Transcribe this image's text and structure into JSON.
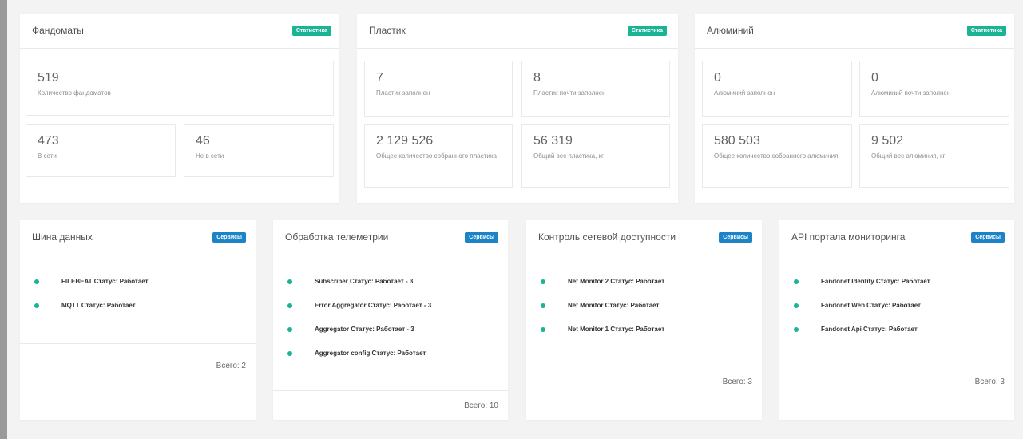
{
  "colors": {
    "accent_green": "#1ab394",
    "accent_blue": "#1c84c6",
    "background": "#f3f3f4"
  },
  "fandomats": {
    "title": "Фандоматы",
    "badge": "Статистика",
    "total_count": {
      "value": "519",
      "label": "Количество фандоматов"
    },
    "online": {
      "value": "473",
      "label": "В сети"
    },
    "offline": {
      "value": "46",
      "label": "Не в сети"
    }
  },
  "plastic": {
    "title": "Пластик",
    "badge": "Статистика",
    "full": {
      "value": "7",
      "label": "Пластик заполнен"
    },
    "almost_full": {
      "value": "8",
      "label": "Пластик почти заполнен"
    },
    "collected": {
      "value": "2 129 526",
      "label": "Общее количество собранного пластика"
    },
    "weight": {
      "value": "56 319",
      "label": "Общий вес пластика, кг"
    }
  },
  "aluminum": {
    "title": "Алюминий",
    "badge": "Статистика",
    "full": {
      "value": "0",
      "label": "Алюминий заполнен"
    },
    "almost_full": {
      "value": "0",
      "label": "Алюминий почти заполнен"
    },
    "collected": {
      "value": "580 503",
      "label": "Общее количество собранного алюминия"
    },
    "weight": {
      "value": "9 502",
      "label": "Общий вес алюминия, кг"
    }
  },
  "data_bus": {
    "title": "Шина данных",
    "badge": "Сервисы",
    "items": [
      "FILEBEAT Статус: Работает",
      "MQTT Статус: Работает"
    ],
    "total": "Всего: 2"
  },
  "telemetry": {
    "title": "Обработка телеметрии",
    "badge": "Сервисы",
    "items": [
      "Subscriber Статус: Работает - 3",
      "Error Aggregator Статус: Работает - 3",
      "Aggregator Статус: Работает - 3",
      "Aggregator config Статус: Работает"
    ],
    "total": "Всего: 10"
  },
  "network": {
    "title": "Контроль сетевой доступности",
    "badge": "Сервисы",
    "items": [
      "Net Monitor 2 Статус: Работает",
      "Net Monitor Статус: Работает",
      "Net Monitor 1 Статус: Работает"
    ],
    "total": "Всего: 3"
  },
  "api_portal": {
    "title": "API портала мониторинга",
    "badge": "Сервисы",
    "items": [
      "Fandonet Identity Статус: Работает",
      "Fandonet Web Статус: Работает",
      "Fandonet Api Статус: Работает"
    ],
    "total": "Всего: 3"
  }
}
